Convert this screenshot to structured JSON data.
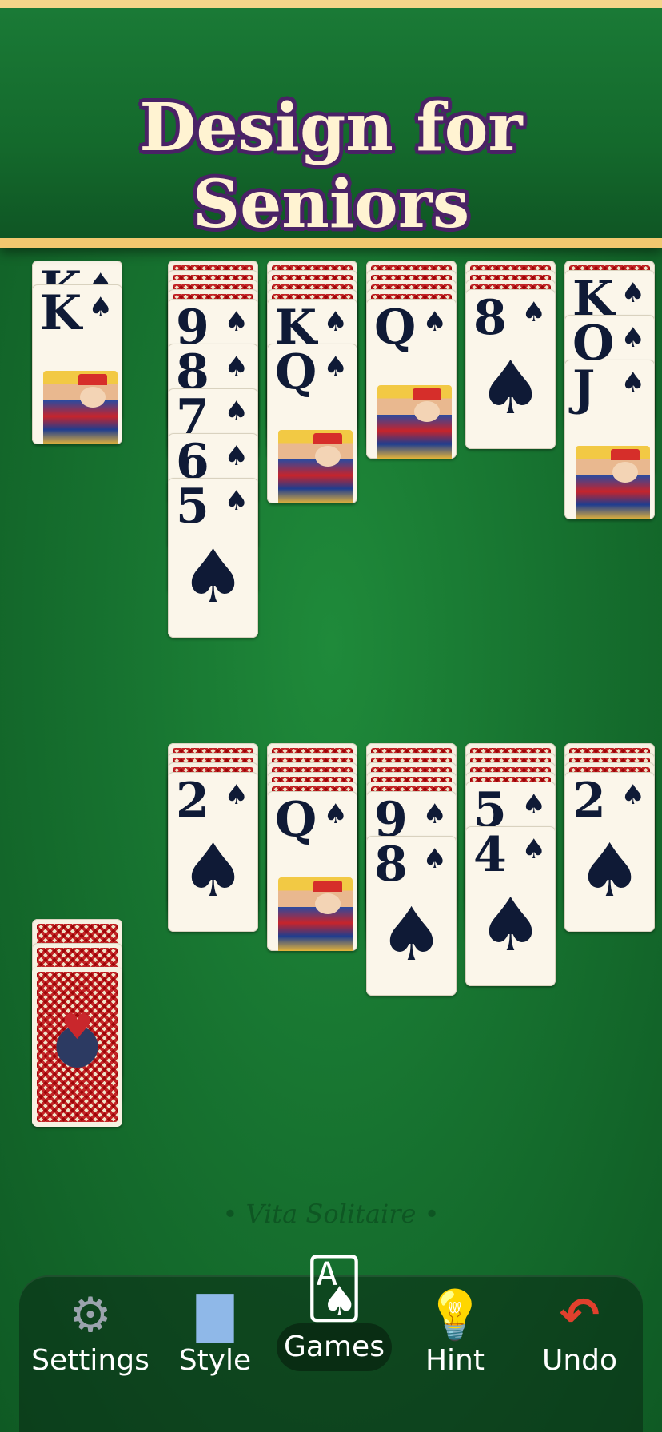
{
  "banner": {
    "title": "Design for Seniors"
  },
  "foundation": {
    "rank": "K",
    "suit": "♠"
  },
  "tableau_top": [
    {
      "hidden": 4,
      "cards": [
        {
          "rank": "9",
          "suit": "♠"
        },
        {
          "rank": "8",
          "suit": "♠"
        },
        {
          "rank": "7",
          "suit": "♠"
        },
        {
          "rank": "6",
          "suit": "♠"
        },
        {
          "rank": "5",
          "suit": "♠"
        }
      ]
    },
    {
      "hidden": 4,
      "cards": [
        {
          "rank": "K",
          "suit": "♠"
        },
        {
          "rank": "Q",
          "suit": "♠"
        }
      ]
    },
    {
      "hidden": 4,
      "cards": [
        {
          "rank": "Q",
          "suit": "♠"
        }
      ]
    },
    {
      "hidden": 3,
      "cards": [
        {
          "rank": "8",
          "suit": "♠"
        }
      ]
    },
    {
      "hidden": 1,
      "cards": [
        {
          "rank": "K",
          "suit": "♠"
        },
        {
          "rank": "Q",
          "suit": "♠"
        },
        {
          "rank": "J",
          "suit": "♠"
        }
      ]
    }
  ],
  "tableau_bottom": [
    {
      "hidden": 3,
      "cards": [
        {
          "rank": "2",
          "suit": "♠"
        }
      ]
    },
    {
      "hidden": 5,
      "cards": [
        {
          "rank": "Q",
          "suit": "♠"
        }
      ]
    },
    {
      "hidden": 5,
      "cards": [
        {
          "rank": "9",
          "suit": "♠"
        },
        {
          "rank": "8",
          "suit": "♠"
        }
      ]
    },
    {
      "hidden": 4,
      "cards": [
        {
          "rank": "5",
          "suit": "♠"
        },
        {
          "rank": "4",
          "suit": "♠"
        }
      ]
    },
    {
      "hidden": 3,
      "cards": [
        {
          "rank": "2",
          "suit": "♠"
        }
      ]
    }
  ],
  "stock": {
    "icon": "spider-icon",
    "heart": "♥"
  },
  "watermark": "• Vita Solitaire •",
  "toolbar": {
    "items": [
      {
        "label": "Settings",
        "icon": "gear-icon",
        "glyph": "⚙",
        "color": "#9aa3ad"
      },
      {
        "label": "Style",
        "icon": "paint-brush-icon",
        "glyph": "▇",
        "color": "#8fb8e8"
      },
      {
        "label": "Games",
        "icon": "cards-icon",
        "glyph": "🂡",
        "color": "#ffffff"
      },
      {
        "label": "Hint",
        "icon": "lightbulb-icon",
        "glyph": "💡",
        "color": "#f5c13a"
      },
      {
        "label": "Undo",
        "icon": "undo-arrow-icon",
        "glyph": "↶",
        "color": "#e0402d"
      }
    ]
  },
  "colors": {
    "felt": "#177330",
    "banner_border": "#f2c86f",
    "card_ink": "#0f1a36",
    "card_back": "#c9272c"
  }
}
